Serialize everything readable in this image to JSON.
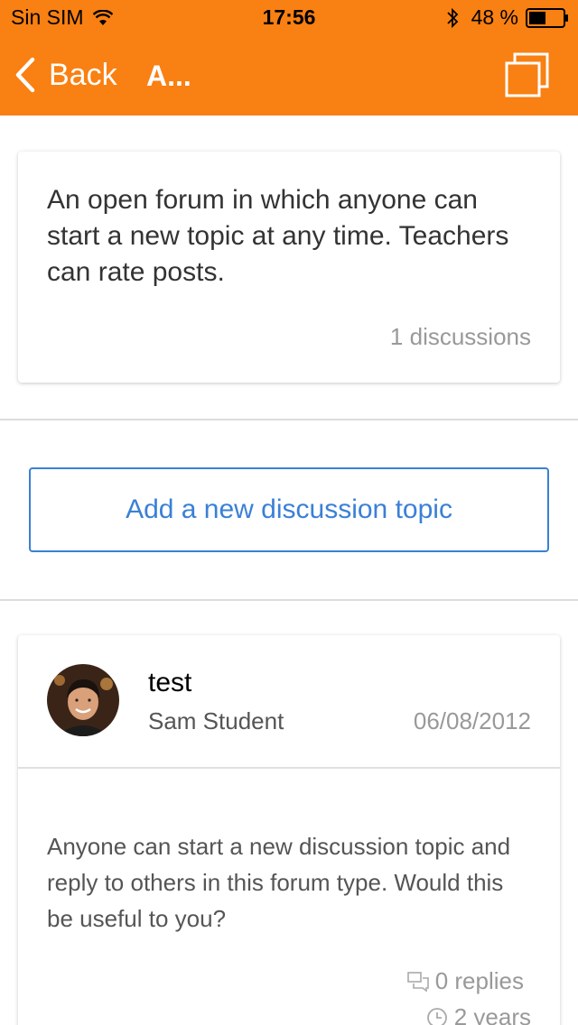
{
  "status_bar": {
    "carrier": "Sin SIM",
    "time": "17:56",
    "battery": "48 %"
  },
  "nav": {
    "back_label": "Back",
    "title": "A...",
    "action_icon": "copy-icon"
  },
  "forum": {
    "description": "An open forum in which anyone can start a new topic at any time. Teachers can rate posts.",
    "discussion_count": "1 discussions"
  },
  "add_topic_label": "Add a new discussion topic",
  "discussions": [
    {
      "title": "test",
      "author": "Sam Student",
      "date": "06/08/2012",
      "message": "Anyone can start a new discussion topic and reply to others in this forum type. Would this be useful to you?",
      "replies": "0 replies",
      "age": "2 years"
    }
  ],
  "colors": {
    "header": "#f98012",
    "link": "#3a80d6"
  }
}
